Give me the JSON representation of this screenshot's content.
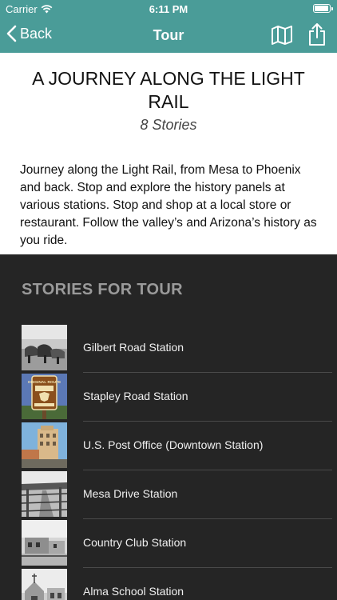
{
  "status_bar": {
    "carrier": "Carrier",
    "time": "6:11 PM",
    "battery_level": 0.95
  },
  "nav": {
    "back_label": "Back",
    "title": "Tour"
  },
  "tour": {
    "title": "A JOURNEY ALONG THE LIGHT RAIL",
    "count": "8 Stories",
    "description": "Journey along the Light Rail, from Mesa to Phoenix and back. Stop and explore the history panels at various stations. Stop and shop at a local store or restaurant. Follow the valley’s and Arizona’s history as you ride."
  },
  "stories_heading": "STORIES FOR TOUR",
  "stories": [
    {
      "label": "Gilbert Road Station"
    },
    {
      "label": "Stapley Road Station",
      "sign_text": "ORIGINAL ROUTE"
    },
    {
      "label": "U.S. Post Office (Downtown Station)"
    },
    {
      "label": "Mesa Drive Station"
    },
    {
      "label": "Country Club Station"
    },
    {
      "label": "Alma School Station"
    }
  ],
  "colors": {
    "nav_bg": "#4a9c98",
    "list_bg": "#252525",
    "heading": "#9a9a9a"
  }
}
